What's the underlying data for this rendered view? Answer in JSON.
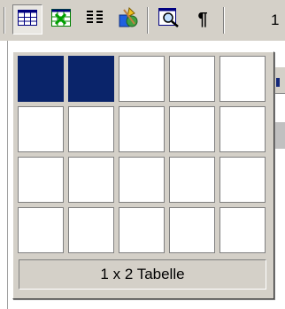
{
  "toolbar": {
    "buttons": [
      {
        "name": "table-grid-icon",
        "pressed": true
      },
      {
        "name": "excel-sheet-icon",
        "pressed": false
      },
      {
        "name": "columns-icon",
        "pressed": false
      },
      {
        "name": "drawing-icon",
        "pressed": false
      },
      {
        "name": "document-map-icon",
        "pressed": false
      },
      {
        "name": "paragraph-marks-icon",
        "pressed": false
      }
    ],
    "paragraph_glyph": "¶",
    "zoom_text_fragment": "1"
  },
  "table_picker": {
    "rows": 4,
    "columns": 5,
    "selected_rows": 1,
    "selected_columns": 2,
    "status_label": "1 x 2 Tabelle"
  },
  "colors": {
    "selected_cell": "#0a246a",
    "face": "#d4d0c8",
    "cell": "#ffffff"
  }
}
